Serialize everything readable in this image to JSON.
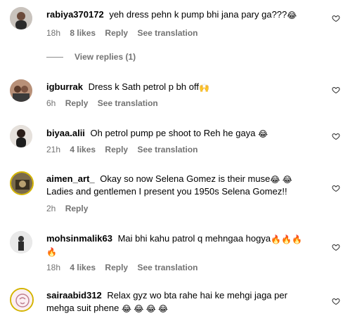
{
  "comments": [
    {
      "username": "rabiya370172",
      "text": "yeh dress pehn k pump bhi jana pary ga???",
      "emoji": "😂",
      "time": "18h",
      "likes": "8 likes",
      "reply": "Reply",
      "translate": "See translation",
      "view_replies": "View replies (1)"
    },
    {
      "username": "igburrak",
      "text": "Dress k Sath petrol p bh off",
      "emoji": "🙌",
      "time": "6h",
      "reply": "Reply",
      "translate": "See translation"
    },
    {
      "username": "biyaa.alii",
      "text": "Oh petrol pump pe shoot to Reh he gaya",
      "emoji": "😂",
      "time": "21h",
      "likes": "4 likes",
      "reply": "Reply",
      "translate": "See translation"
    },
    {
      "username": "aimen_art_",
      "text": "Okay so now Selena Gomez is their muse",
      "emoji": "😂 😂",
      "text2": "Ladies and gentlemen I present you 1950s Selena Gomez!!",
      "time": "2h",
      "reply": "Reply"
    },
    {
      "username": "mohsinmalik63",
      "text": "Mai bhi kahu patrol q mehngaa hogya",
      "emoji": "🔥🔥🔥",
      "emoji2": "🔥",
      "time": "18h",
      "likes": "4 likes",
      "reply": "Reply",
      "translate": "See translation"
    },
    {
      "username": "sairaabid312",
      "text": "Relax gyz wo bta rahe hai ke mehgi jaga per",
      "text2": "mehga suit phene",
      "emoji": "😂 😂 😂 😂"
    }
  ],
  "icons": {
    "heart": "heart-outline-icon"
  },
  "colors": {
    "meta": "#737373",
    "text": "#000000"
  }
}
